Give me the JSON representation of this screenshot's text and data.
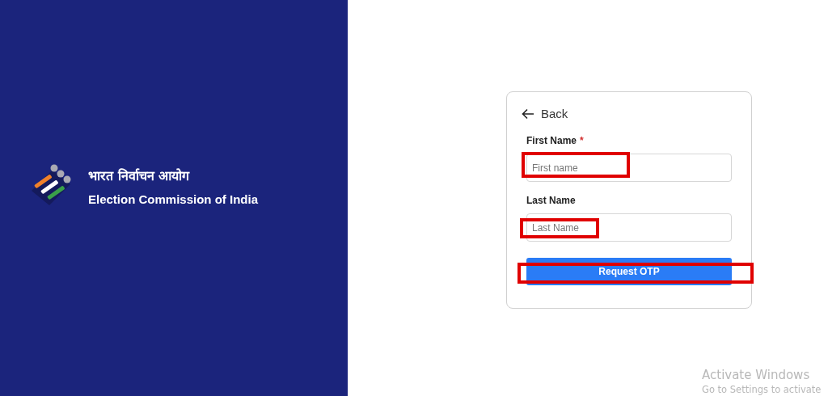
{
  "brand": {
    "title_hindi": "भारत निर्वाचन आयोग",
    "title_english": "Election Commission of India"
  },
  "form": {
    "back_link": "Back",
    "required_mark": "*",
    "fields": [
      {
        "label": "First Name",
        "required": true,
        "placeholder": "First name",
        "highlighted": true
      },
      {
        "label": "Last Name",
        "required": false,
        "placeholder": "Last Name",
        "highlighted": true
      }
    ],
    "submit": {
      "label": "Request OTP",
      "highlighted": true
    }
  },
  "os_notice": {
    "title": "Activate Windows",
    "message": "Go to Settings to activate"
  }
}
